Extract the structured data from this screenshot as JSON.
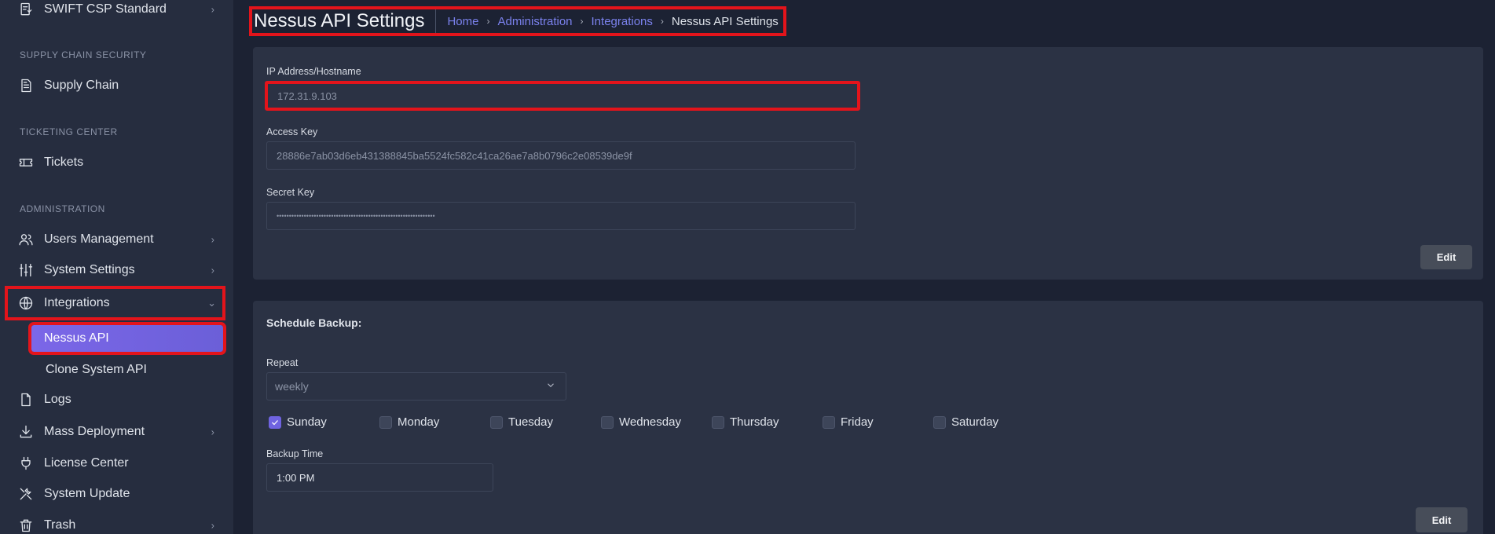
{
  "sidebar": {
    "items_top": [
      {
        "label": "SWIFT CSP Standard",
        "icon": "compliance-shield-icon",
        "has_chevron": true
      }
    ],
    "sections": {
      "supply_chain": "SUPPLY CHAIN SECURITY",
      "ticketing": "TICKETING CENTER",
      "administration": "ADMINISTRATION"
    },
    "supply_chain": {
      "label": "Supply Chain",
      "icon": "document-icon"
    },
    "tickets": {
      "label": "Tickets",
      "icon": "ticket-icon"
    },
    "admin": [
      {
        "label": "Users Management",
        "icon": "users-icon",
        "chevron": "›"
      },
      {
        "label": "System Settings",
        "icon": "sliders-icon",
        "chevron": "›"
      },
      {
        "label": "Integrations",
        "icon": "globe-icon",
        "chevron": "⌄"
      }
    ],
    "integrations_sub": [
      {
        "label": "Nessus API",
        "active": true
      },
      {
        "label": "Clone System API",
        "active": false
      }
    ],
    "bottom": [
      {
        "label": "Logs",
        "icon": "file-icon",
        "chevron": ""
      },
      {
        "label": "Mass Deployment",
        "icon": "download-icon",
        "chevron": "›"
      },
      {
        "label": "License Center",
        "icon": "plug-icon",
        "chevron": ""
      },
      {
        "label": "System Update",
        "icon": "tools-icon",
        "chevron": ""
      },
      {
        "label": "Trash",
        "icon": "trash-icon",
        "chevron": "›"
      }
    ],
    "chevron_right": "›"
  },
  "header": {
    "title": "Nessus API Settings",
    "breadcrumb": [
      "Home",
      "Administration",
      "Integrations"
    ],
    "breadcrumb_current": "Nessus API Settings"
  },
  "api_card": {
    "ip_label": "IP Address/Hostname",
    "ip_value": "172.31.9.103",
    "access_label": "Access Key",
    "access_value": "28886e7ab03d6eb431388845ba5524fc582c41ca26ae7a8b0796c2e08539de9f",
    "secret_label": "Secret Key",
    "secret_value": "••••••••••••••••••••••••••••••••••••••••••••••••••••••••••••••••",
    "edit_label": "Edit"
  },
  "backup_card": {
    "title": "Schedule Backup:",
    "repeat_label": "Repeat",
    "repeat_value": "weekly",
    "days": [
      {
        "label": "Sunday",
        "checked": true
      },
      {
        "label": "Monday",
        "checked": false
      },
      {
        "label": "Tuesday",
        "checked": false
      },
      {
        "label": "Wednesday",
        "checked": false
      },
      {
        "label": "Thursday",
        "checked": false
      },
      {
        "label": "Friday",
        "checked": false
      },
      {
        "label": "Saturday",
        "checked": false
      }
    ],
    "time_label": "Backup Time",
    "time_value": "1:00 PM",
    "edit_label": "Edit"
  },
  "colors": {
    "accent": "#6f63e0",
    "highlight": "#e3141b",
    "link": "#7b82ee"
  }
}
